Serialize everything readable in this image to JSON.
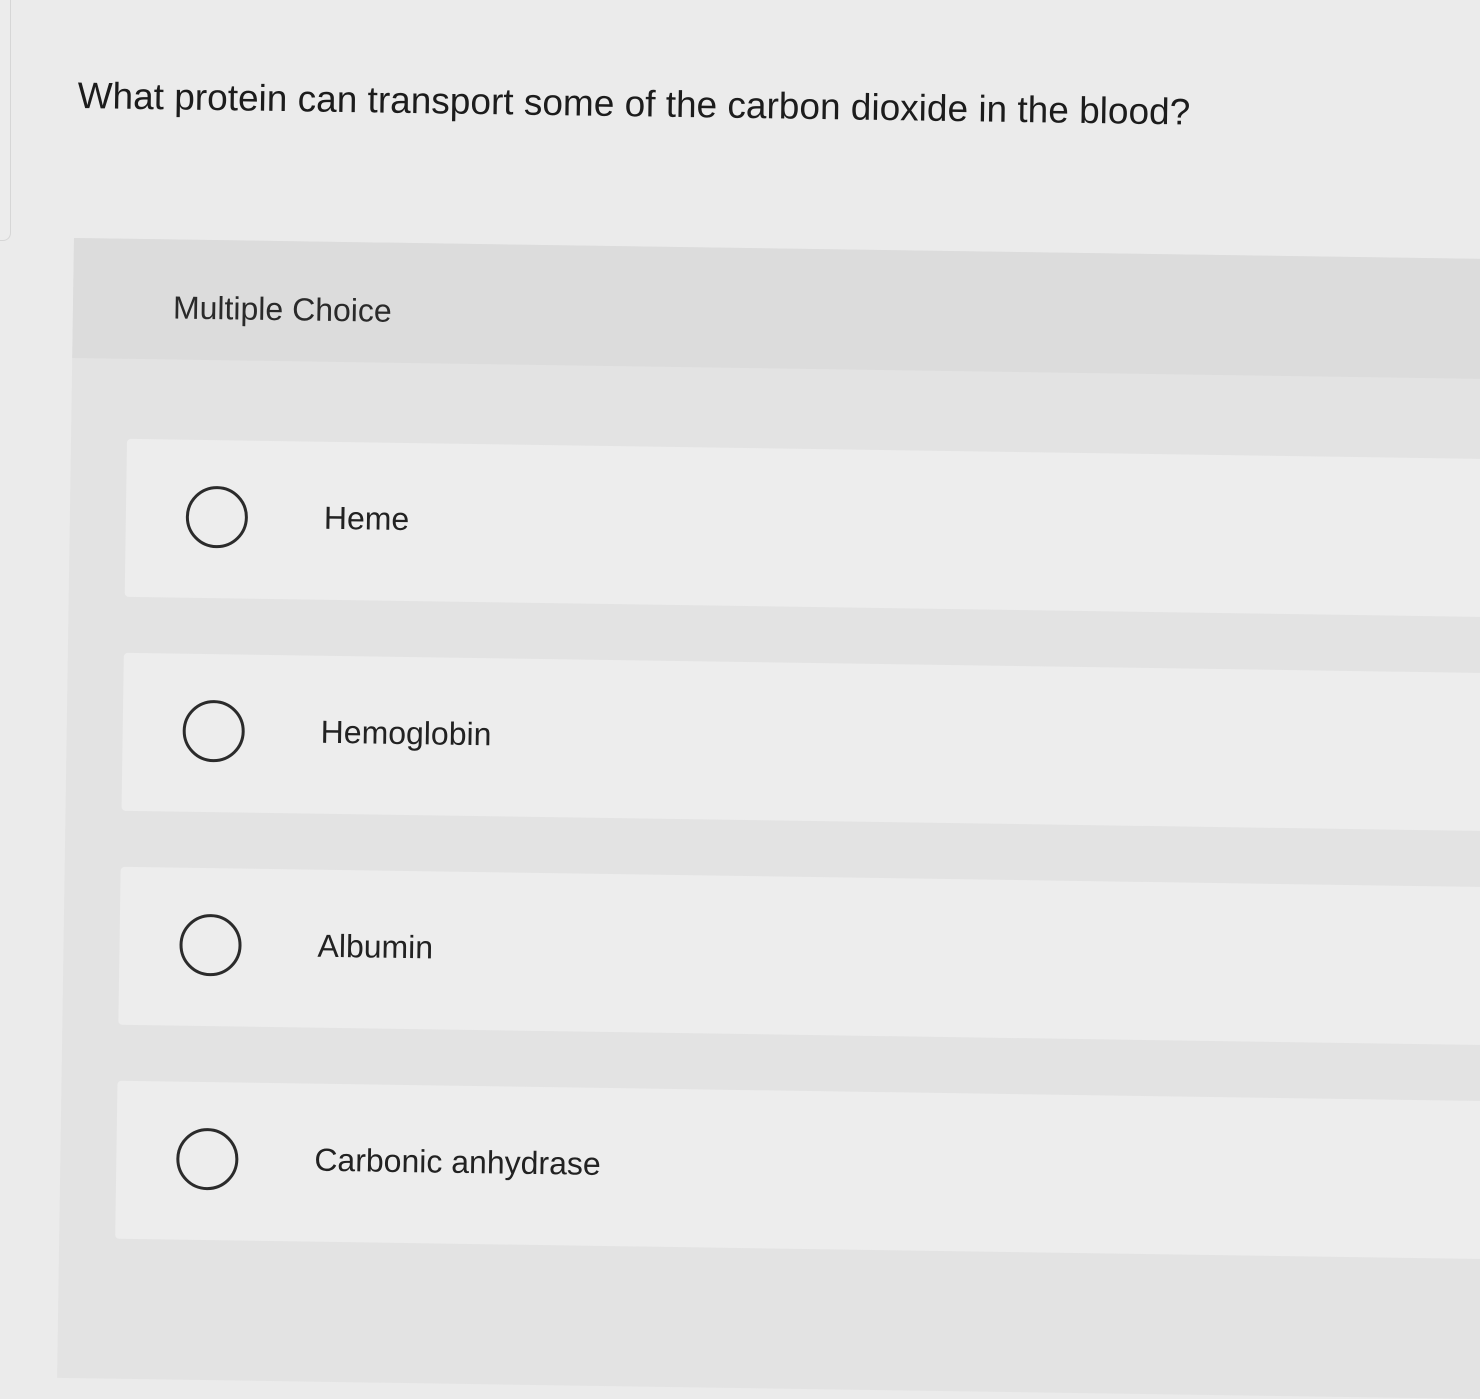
{
  "question": {
    "text": "What protein can transport some of the carbon dioxide in the blood?"
  },
  "panel": {
    "label": "Multiple Choice"
  },
  "choices": [
    {
      "label": "Heme",
      "selected": false
    },
    {
      "label": "Hemoglobin",
      "selected": false
    },
    {
      "label": "Albumin",
      "selected": false
    },
    {
      "label": "Carbonic anhydrase",
      "selected": false
    }
  ]
}
